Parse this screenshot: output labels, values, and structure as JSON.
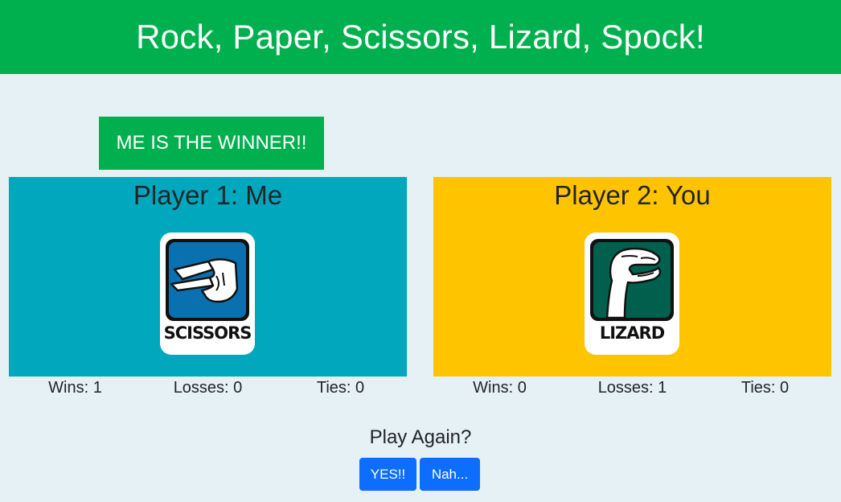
{
  "header": {
    "title": "Rock, Paper, Scissors, Lizard, Spock!"
  },
  "result": {
    "winner_text": "ME IS THE WINNER!!"
  },
  "player1": {
    "title": "Player 1: Me",
    "choice_label": "SCISSORS",
    "choice_icon": "scissors-hand-icon",
    "panel_color": "#00a7bd",
    "stats": {
      "wins": "Wins: 1",
      "losses": "Losses: 0",
      "ties": "Ties: 0"
    }
  },
  "player2": {
    "title": "Player 2: You",
    "choice_label": "LIZARD",
    "choice_icon": "lizard-hand-icon",
    "panel_color": "#ffc400",
    "stats": {
      "wins": "Wins: 0",
      "losses": "Losses: 1",
      "ties": "Ties: 0"
    }
  },
  "play_again": {
    "prompt": "Play Again?",
    "yes_label": "YES!!",
    "no_label": "Nah..."
  },
  "colors": {
    "header": "#00b04f",
    "background": "#e5f1f4",
    "button": "#0d6efd"
  }
}
